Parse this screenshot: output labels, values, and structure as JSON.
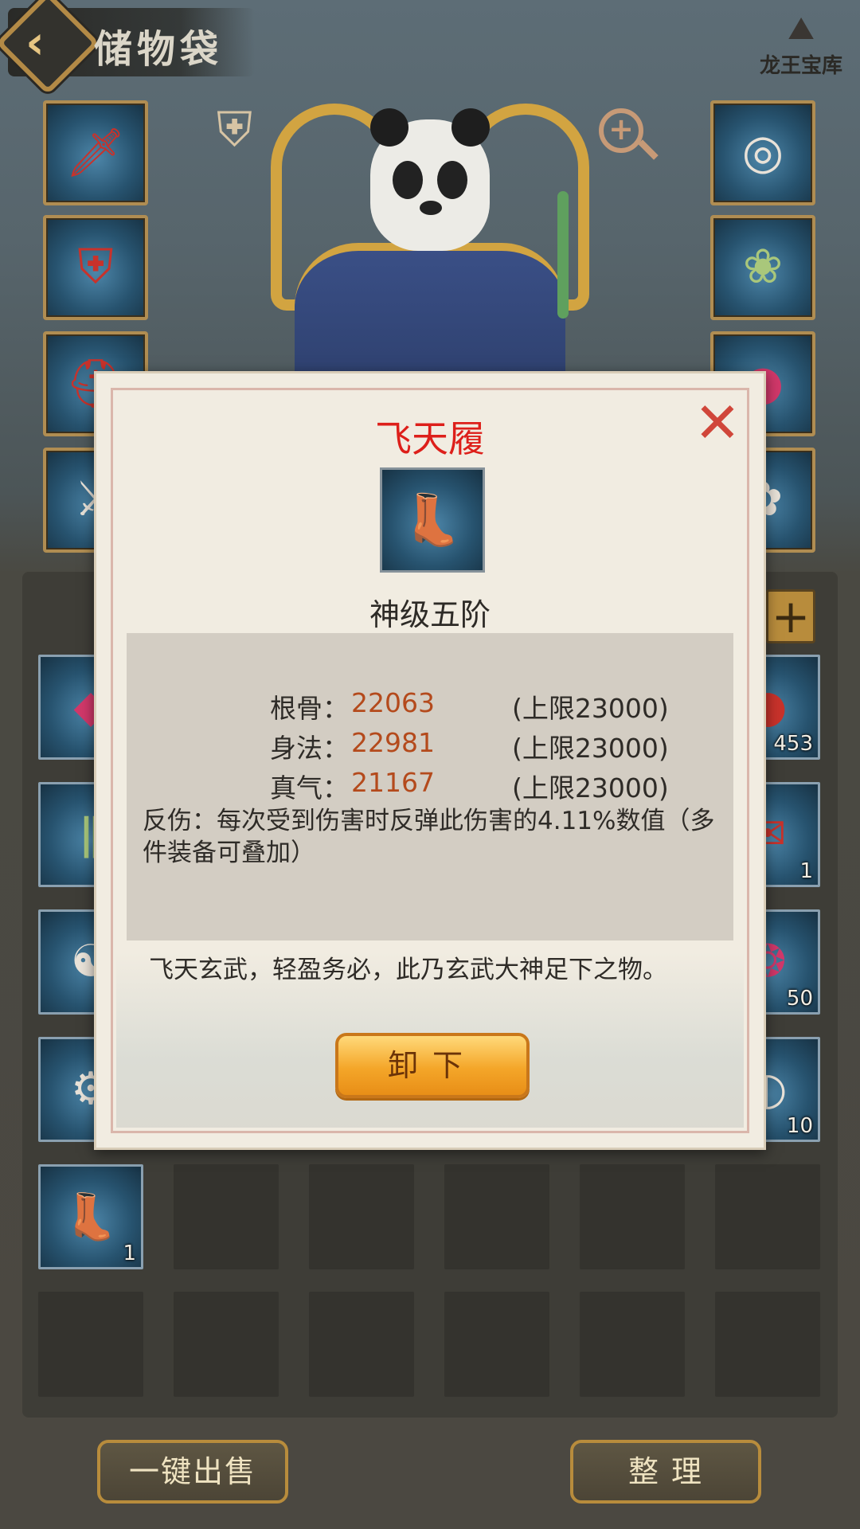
{
  "header": {
    "title": "储物袋",
    "treasury_label": "龙王宝库"
  },
  "equipment_left": [
    {
      "icon": "sword-icon",
      "glyph": "🗡",
      "color": "red"
    },
    {
      "icon": "robe-armor-icon",
      "glyph": "⛨",
      "color": "red"
    },
    {
      "icon": "helmet-icon",
      "glyph": "⛑",
      "color": "red"
    },
    {
      "icon": "bracer-icon",
      "glyph": "⚔",
      "color": "white"
    }
  ],
  "equipment_right": [
    {
      "icon": "ring-icon",
      "glyph": "◎",
      "color": "white"
    },
    {
      "icon": "jade-pendant-icon",
      "glyph": "❀",
      "color": "green"
    },
    {
      "icon": "orb-icon",
      "glyph": "●",
      "color": "pink"
    },
    {
      "icon": "amulet-icon",
      "glyph": "✿",
      "color": "white"
    }
  ],
  "inventory": {
    "rows": [
      [
        {
          "filled": true,
          "icon": "crystal-shard-icon",
          "glyph": "◆",
          "color": "pink"
        },
        {
          "filled": false
        },
        {
          "filled": false
        },
        {
          "filled": false
        },
        {
          "filled": false
        },
        {
          "filled": true,
          "icon": "red-orb-icon",
          "glyph": "●",
          "color": "red",
          "count": "453"
        }
      ],
      [
        {
          "filled": true,
          "icon": "bamboo-icon",
          "glyph": "ǁ",
          "color": "green"
        },
        {
          "filled": false
        },
        {
          "filled": false
        },
        {
          "filled": false
        },
        {
          "filled": false
        },
        {
          "filled": true,
          "icon": "pouch-icon",
          "glyph": "✉",
          "color": "red",
          "count": "1"
        }
      ],
      [
        {
          "filled": true,
          "icon": "yin-yang-icon",
          "glyph": "☯",
          "color": "white"
        },
        {
          "filled": false
        },
        {
          "filled": false
        },
        {
          "filled": false
        },
        {
          "filled": false
        },
        {
          "filled": true,
          "icon": "pink-gem-icon",
          "glyph": "❂",
          "color": "pink",
          "count": "50"
        }
      ],
      [
        {
          "filled": true,
          "icon": "gear-ring-icon",
          "glyph": "⚙",
          "color": "white"
        },
        {
          "filled": false
        },
        {
          "filled": false
        },
        {
          "filled": false
        },
        {
          "filled": false
        },
        {
          "filled": true,
          "icon": "blue-orb-icon",
          "glyph": "◐",
          "color": "white",
          "count": "10"
        }
      ],
      [
        {
          "filled": true,
          "icon": "boots-icon",
          "glyph": "👢",
          "color": "red",
          "count": "1"
        },
        {
          "filled": false
        },
        {
          "filled": false
        },
        {
          "filled": false
        },
        {
          "filled": false
        },
        {
          "filled": false
        }
      ],
      [
        {
          "filled": false
        },
        {
          "filled": false
        },
        {
          "filled": false
        },
        {
          "filled": false
        },
        {
          "filled": false
        },
        {
          "filled": false
        }
      ]
    ]
  },
  "buttons": {
    "sell_all": "一键出售",
    "sort": "整 理",
    "expand": "+"
  },
  "modal": {
    "item_name": "飞天履",
    "item_icon": "boots-icon",
    "grade": "神级五阶",
    "close": "✕",
    "stats": [
      {
        "label": "根骨：",
        "value": "22063",
        "limit": "(上限23000)"
      },
      {
        "label": "身法：",
        "value": "22981",
        "limit": "(上限23000)"
      },
      {
        "label": "真气：",
        "value": "21167",
        "limit": "(上限23000)"
      }
    ],
    "effect": "反伤：每次受到伤害时反弹此伤害的4.11%数值（多件装备可叠加）",
    "flavor": "飞天玄武，轻盈务必，此乃玄武大神足下之物。",
    "unequip": "卸下"
  },
  "colors": {
    "item_name": "#dd1f1a",
    "stat_value": "#b44a1c",
    "gold_border": "#b88c3c"
  }
}
